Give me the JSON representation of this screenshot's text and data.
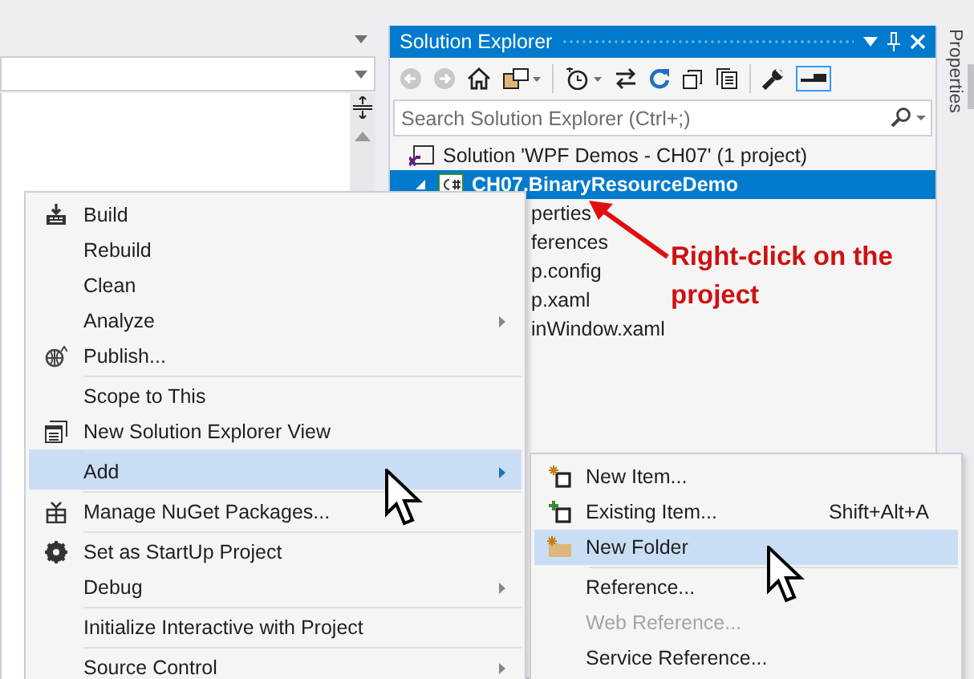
{
  "solution_explorer": {
    "title": "Solution Explorer",
    "search": {
      "placeholder": "Search Solution Explorer (Ctrl+;)"
    },
    "tree": [
      {
        "label": "Solution 'WPF Demos - CH07' (1 project)",
        "kind": "solution",
        "selected": false,
        "children": [
          {
            "label": "CH07.BinaryResourceDemo",
            "kind": "project",
            "selected": true,
            "expanded": true,
            "children": [
              {
                "label": "perties",
                "selected": false
              },
              {
                "label": "ferences",
                "selected": false
              },
              {
                "label": "p.config",
                "selected": false
              },
              {
                "label": "p.xaml",
                "selected": false
              },
              {
                "label": "inWindow.xaml",
                "selected": false
              }
            ]
          }
        ]
      }
    ]
  },
  "properties_tab": "Properties",
  "annotation": "Right-click on the project",
  "context_menu": [
    {
      "label": "Build",
      "kind": "build",
      "selected": false,
      "submenu": false,
      "separator_before": false
    },
    {
      "label": "Rebuild",
      "selected": false,
      "submenu": false,
      "separator_before": false
    },
    {
      "label": "Clean",
      "selected": false,
      "submenu": false,
      "separator_before": false
    },
    {
      "label": "Analyze",
      "selected": false,
      "submenu": true,
      "separator_before": false
    },
    {
      "label": "Publish...",
      "kind": "publish",
      "selected": false,
      "submenu": false,
      "separator_before": false
    },
    {
      "label": "Scope to This",
      "selected": false,
      "submenu": false,
      "separator_before": true
    },
    {
      "label": "New Solution Explorer View",
      "kind": "view",
      "selected": false,
      "submenu": false,
      "separator_before": false
    },
    {
      "label": "Add",
      "selected": true,
      "submenu": true,
      "separator_before": true
    },
    {
      "label": "Manage NuGet Packages...",
      "kind": "packages",
      "selected": false,
      "submenu": false,
      "separator_before": true
    },
    {
      "label": "Set as StartUp Project",
      "kind": "startup",
      "selected": false,
      "submenu": false,
      "separator_before": true
    },
    {
      "label": "Debug",
      "selected": false,
      "submenu": true,
      "separator_before": false
    },
    {
      "label": "Initialize Interactive with Project",
      "selected": false,
      "submenu": false,
      "separator_before": true
    },
    {
      "label": "Source Control",
      "selected": false,
      "submenu": true,
      "separator_before": true
    }
  ],
  "add_submenu": [
    {
      "label": "New Item...",
      "kind": "new-item",
      "selected": false,
      "disabled": false,
      "separator_before": false
    },
    {
      "label": "Existing Item...",
      "kind": "existing-item",
      "shortcut": "Shift+Alt+A",
      "selected": false,
      "disabled": false,
      "separator_before": false
    },
    {
      "label": "New Folder",
      "kind": "new-folder",
      "selected": true,
      "disabled": false,
      "separator_before": false
    },
    {
      "label": "Reference...",
      "selected": false,
      "disabled": false,
      "separator_before": true
    },
    {
      "label": "Web Reference...",
      "selected": false,
      "disabled": true,
      "separator_before": false
    },
    {
      "label": "Service Reference...",
      "selected": false,
      "disabled": false,
      "separator_before": false
    }
  ]
}
